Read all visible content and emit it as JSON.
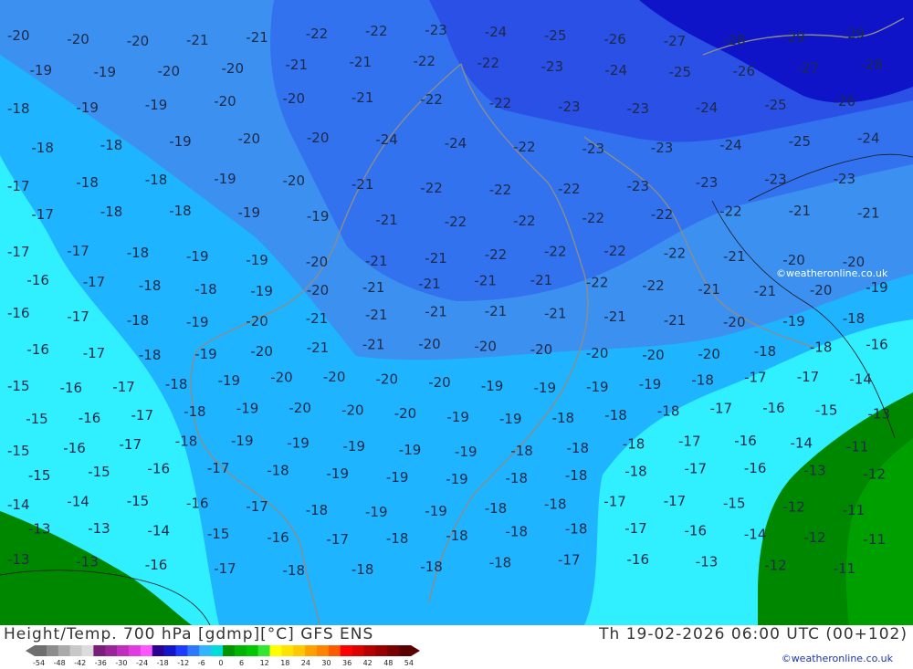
{
  "header": {
    "title_left": "Height/Temp. 700 hPa [gdmp][°C] GFS ENS",
    "title_right": "Th 19-02-2026 06:00 UTC (00+102)"
  },
  "credits": {
    "map": "©weatheronline.co.uk",
    "footer": "©weatheronline.co.uk"
  },
  "legend": {
    "labels": [
      "-54",
      "-48",
      "-42",
      "-36",
      "-30",
      "-24",
      "-18",
      "-12",
      "-6",
      "0",
      "6",
      "12",
      "18",
      "24",
      "30",
      "36",
      "42",
      "48",
      "54"
    ],
    "colors": [
      "#6e6e6e",
      "#8c8c8c",
      "#aaaaaa",
      "#c8c8c8",
      "#dcdcdc",
      "#7a1f7a",
      "#9a259a",
      "#c02ec0",
      "#e03ae0",
      "#ff55ff",
      "#2a0094",
      "#1414c8",
      "#1e3cff",
      "#2e78ff",
      "#32b4ff",
      "#00dcdc",
      "#009600",
      "#00b400",
      "#00c800",
      "#32e632",
      "#ffff00",
      "#ffe200",
      "#ffc800",
      "#ffa000",
      "#ff8200",
      "#ff5a00",
      "#ff0000",
      "#dc0000",
      "#b40000",
      "#960000",
      "#780000",
      "#5a0000"
    ]
  },
  "map": {
    "region_colors": {
      "cyan": "#30f0ff",
      "light_blue": "#1eb4ff",
      "mid_blue": "#3c91f0",
      "blue": "#3272ef",
      "deep_blue": "#2a50e6",
      "darkest_blue": "#0f14c8",
      "green_dark": "#008700",
      "green_light": "#009f00",
      "coast": "#8c8c8c",
      "isoline_text": "#1d2a48"
    },
    "temperature_labels": [
      {
        "text": "-20"
      },
      {
        "text": "-20"
      },
      {
        "text": "-20"
      },
      {
        "text": "-21"
      },
      {
        "text": "-21"
      },
      {
        "text": "-22"
      },
      {
        "text": "-22"
      },
      {
        "text": "-23"
      },
      {
        "text": "-24"
      },
      {
        "text": "-25"
      },
      {
        "text": "-26"
      },
      {
        "text": "-27"
      },
      {
        "text": "-28"
      },
      {
        "text": "-29"
      },
      {
        "text": "-29"
      },
      {
        "text": "-19"
      },
      {
        "text": "-19"
      },
      {
        "text": "-20"
      },
      {
        "text": "-20"
      },
      {
        "text": "-21"
      },
      {
        "text": "-21"
      },
      {
        "text": "-22"
      },
      {
        "text": "-22"
      },
      {
        "text": "-23"
      },
      {
        "text": "-24"
      },
      {
        "text": "-25"
      },
      {
        "text": "-26"
      },
      {
        "text": "-27"
      },
      {
        "text": "-28"
      },
      {
        "text": "-18"
      },
      {
        "text": "-19"
      },
      {
        "text": "-19"
      },
      {
        "text": "-20"
      },
      {
        "text": "-20"
      },
      {
        "text": "-21"
      },
      {
        "text": "-22"
      },
      {
        "text": "-22"
      },
      {
        "text": "-23"
      },
      {
        "text": "-23"
      },
      {
        "text": "-24"
      },
      {
        "text": "-25"
      },
      {
        "text": "-26"
      },
      {
        "text": "-18"
      },
      {
        "text": "-18"
      },
      {
        "text": "-19"
      },
      {
        "text": "-20"
      },
      {
        "text": "-20"
      },
      {
        "text": "-24"
      },
      {
        "text": "-24"
      },
      {
        "text": "-22"
      },
      {
        "text": "-23"
      },
      {
        "text": "-23"
      },
      {
        "text": "-24"
      },
      {
        "text": "-25"
      },
      {
        "text": "-24"
      },
      {
        "text": "-17"
      },
      {
        "text": "-18"
      },
      {
        "text": "-18"
      },
      {
        "text": "-19"
      },
      {
        "text": "-20"
      },
      {
        "text": "-21"
      },
      {
        "text": "-22"
      },
      {
        "text": "-22"
      },
      {
        "text": "-22"
      },
      {
        "text": "-23"
      },
      {
        "text": "-23"
      },
      {
        "text": "-23"
      },
      {
        "text": "-23"
      },
      {
        "text": "-17"
      },
      {
        "text": "-18"
      },
      {
        "text": "-18"
      },
      {
        "text": "-19"
      },
      {
        "text": "-19"
      },
      {
        "text": "-21"
      },
      {
        "text": "-22"
      },
      {
        "text": "-22"
      },
      {
        "text": "-22"
      },
      {
        "text": "-22"
      },
      {
        "text": "-22"
      },
      {
        "text": "-21"
      },
      {
        "text": "-21"
      },
      {
        "text": "-17"
      },
      {
        "text": "-17"
      },
      {
        "text": "-18"
      },
      {
        "text": "-19"
      },
      {
        "text": "-19"
      },
      {
        "text": "-20"
      },
      {
        "text": "-21"
      },
      {
        "text": "-21"
      },
      {
        "text": "-22"
      },
      {
        "text": "-22"
      },
      {
        "text": "-22"
      },
      {
        "text": "-22"
      },
      {
        "text": "-21"
      },
      {
        "text": "-20"
      },
      {
        "text": "-20"
      },
      {
        "text": "-16"
      },
      {
        "text": "-17"
      },
      {
        "text": "-18"
      },
      {
        "text": "-18"
      },
      {
        "text": "-19"
      },
      {
        "text": "-20"
      },
      {
        "text": "-21"
      },
      {
        "text": "-21"
      },
      {
        "text": "-21"
      },
      {
        "text": "-21"
      },
      {
        "text": "-22"
      },
      {
        "text": "-22"
      },
      {
        "text": "-21"
      },
      {
        "text": "-21"
      },
      {
        "text": "-20"
      },
      {
        "text": "-19"
      },
      {
        "text": "-16"
      },
      {
        "text": "-17"
      },
      {
        "text": "-18"
      },
      {
        "text": "-19"
      },
      {
        "text": "-20"
      },
      {
        "text": "-21"
      },
      {
        "text": "-21"
      },
      {
        "text": "-21"
      },
      {
        "text": "-21"
      },
      {
        "text": "-21"
      },
      {
        "text": "-21"
      },
      {
        "text": "-21"
      },
      {
        "text": "-20"
      },
      {
        "text": "-19"
      },
      {
        "text": "-18"
      },
      {
        "text": "-16"
      },
      {
        "text": "-17"
      },
      {
        "text": "-18"
      },
      {
        "text": "-19"
      },
      {
        "text": "-20"
      },
      {
        "text": "-21"
      },
      {
        "text": "-21"
      },
      {
        "text": "-20"
      },
      {
        "text": "-20"
      },
      {
        "text": "-20"
      },
      {
        "text": "-20"
      },
      {
        "text": "-20"
      },
      {
        "text": "-20"
      },
      {
        "text": "-18"
      },
      {
        "text": "-18"
      },
      {
        "text": "-16"
      },
      {
        "text": "-15"
      },
      {
        "text": "-16"
      },
      {
        "text": "-17"
      },
      {
        "text": "-18"
      },
      {
        "text": "-19"
      },
      {
        "text": "-20"
      },
      {
        "text": "-20"
      },
      {
        "text": "-20"
      },
      {
        "text": "-20"
      },
      {
        "text": "-19"
      },
      {
        "text": "-19"
      },
      {
        "text": "-19"
      },
      {
        "text": "-19"
      },
      {
        "text": "-18"
      },
      {
        "text": "-17"
      },
      {
        "text": "-17"
      },
      {
        "text": "-14"
      },
      {
        "text": "-15"
      },
      {
        "text": "-16"
      },
      {
        "text": "-17"
      },
      {
        "text": "-18"
      },
      {
        "text": "-19"
      },
      {
        "text": "-20"
      },
      {
        "text": "-20"
      },
      {
        "text": "-20"
      },
      {
        "text": "-19"
      },
      {
        "text": "-19"
      },
      {
        "text": "-18"
      },
      {
        "text": "-18"
      },
      {
        "text": "-18"
      },
      {
        "text": "-17"
      },
      {
        "text": "-16"
      },
      {
        "text": "-15"
      },
      {
        "text": "-13"
      },
      {
        "text": "-15"
      },
      {
        "text": "-16"
      },
      {
        "text": "-17"
      },
      {
        "text": "-18"
      },
      {
        "text": "-19"
      },
      {
        "text": "-19"
      },
      {
        "text": "-19"
      },
      {
        "text": "-19"
      },
      {
        "text": "-19"
      },
      {
        "text": "-18"
      },
      {
        "text": "-18"
      },
      {
        "text": "-18"
      },
      {
        "text": "-17"
      },
      {
        "text": "-16"
      },
      {
        "text": "-14"
      },
      {
        "text": "-11"
      },
      {
        "text": "-15"
      },
      {
        "text": "-15"
      },
      {
        "text": "-16"
      },
      {
        "text": "-17"
      },
      {
        "text": "-18"
      },
      {
        "text": "-19"
      },
      {
        "text": "-19"
      },
      {
        "text": "-19"
      },
      {
        "text": "-18"
      },
      {
        "text": "-18"
      },
      {
        "text": "-18"
      },
      {
        "text": "-17"
      },
      {
        "text": "-16"
      },
      {
        "text": "-13"
      },
      {
        "text": "-12"
      },
      {
        "text": "-14"
      },
      {
        "text": "-14"
      },
      {
        "text": "-15"
      },
      {
        "text": "-16"
      },
      {
        "text": "-17"
      },
      {
        "text": "-18"
      },
      {
        "text": "-19"
      },
      {
        "text": "-19"
      },
      {
        "text": "-18"
      },
      {
        "text": "-18"
      },
      {
        "text": "-17"
      },
      {
        "text": "-17"
      },
      {
        "text": "-15"
      },
      {
        "text": "-12"
      },
      {
        "text": "-11"
      },
      {
        "text": "-13"
      },
      {
        "text": "-13"
      },
      {
        "text": "-14"
      },
      {
        "text": "-15"
      },
      {
        "text": "-16"
      },
      {
        "text": "-17"
      },
      {
        "text": "-18"
      },
      {
        "text": "-18"
      },
      {
        "text": "-18"
      },
      {
        "text": "-18"
      },
      {
        "text": "-17"
      },
      {
        "text": "-16"
      },
      {
        "text": "-14"
      },
      {
        "text": "-12"
      },
      {
        "text": "-11"
      },
      {
        "text": "-13"
      },
      {
        "text": "-13"
      },
      {
        "text": "-16"
      },
      {
        "text": "-17"
      },
      {
        "text": "-18"
      },
      {
        "text": "-18"
      },
      {
        "text": "-18"
      },
      {
        "text": "-18"
      },
      {
        "text": "-17"
      },
      {
        "text": "-16"
      },
      {
        "text": "-13"
      },
      {
        "text": "-12"
      },
      {
        "text": "-11"
      }
    ]
  }
}
